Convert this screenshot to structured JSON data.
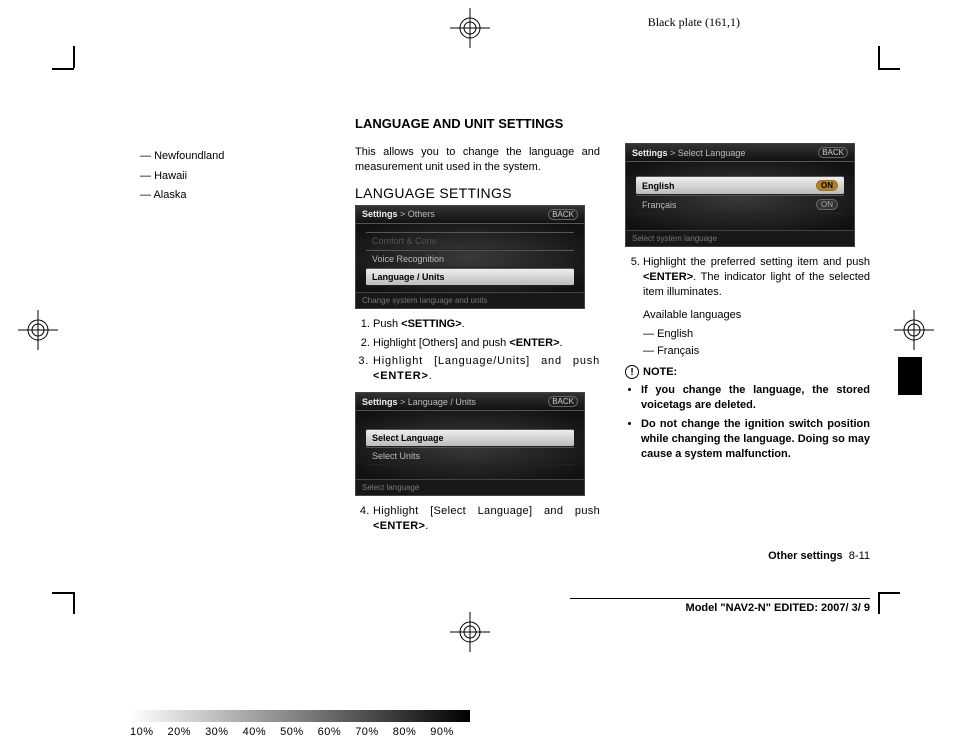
{
  "header": {
    "plate": "Black plate (161,1)"
  },
  "leftcol": {
    "items": [
      "Newfoundland",
      "Hawaii",
      "Alaska"
    ]
  },
  "main": {
    "title": "LANGUAGE AND UNIT SETTINGS",
    "intro": "This allows you to change the language and measurement unit used in the system.",
    "subtitle": "LANGUAGE SETTINGS"
  },
  "screens": {
    "s1": {
      "crumb_main": "Settings",
      "crumb_sub": "> Others",
      "back": "BACK",
      "row_dim": "Comfort & Conv.",
      "row1": "Voice Recognition",
      "row2": "Language / Units",
      "footer": "Change system language and units"
    },
    "s2": {
      "crumb_main": "Settings",
      "crumb_sub": "> Language / Units",
      "back": "BACK",
      "row1": "Select Language",
      "row2": "Select Units",
      "footer": "Select language"
    },
    "s3": {
      "crumb_main": "Settings",
      "crumb_sub": "> Select Language",
      "back": "BACK",
      "row1": "English",
      "row2": "Français",
      "pill_on": "ON",
      "pill_off": "ON",
      "footer": "Select system language"
    }
  },
  "steps": {
    "s1": {
      "pre": "Push ",
      "b": "<SETTING>",
      "post": "."
    },
    "s2": {
      "pre": "Highlight [Others] and push ",
      "b": "<ENTER>",
      "post": "."
    },
    "s3": {
      "pre": "Highlight [Language/Units] and push ",
      "b": "<ENTER>",
      "post": "."
    },
    "s4": {
      "pre": "Highlight [Select Language] and push ",
      "b": "<ENTER>",
      "post": "."
    },
    "s5": {
      "pre": "Highlight the preferred setting item and push ",
      "b": "<ENTER>",
      "post": ". The indicator light of the selected item illuminates."
    }
  },
  "avail": {
    "label": "Available languages",
    "items": [
      "English",
      "Français"
    ]
  },
  "note": {
    "label": "NOTE:",
    "items": [
      "If you change the language, the stored voicetags are deleted.",
      "Do not change the ignition switch position while changing the language. Doing so may cause a system malfunction."
    ]
  },
  "footer": {
    "section_b": "Other settings",
    "section_n": "8-11",
    "model": "Model \"NAV2-N\" EDITED: 2007/ 3/ 9"
  },
  "pct": [
    "10%",
    "20%",
    "30%",
    "40%",
    "50%",
    "60%",
    "70%",
    "80%",
    "90%"
  ]
}
